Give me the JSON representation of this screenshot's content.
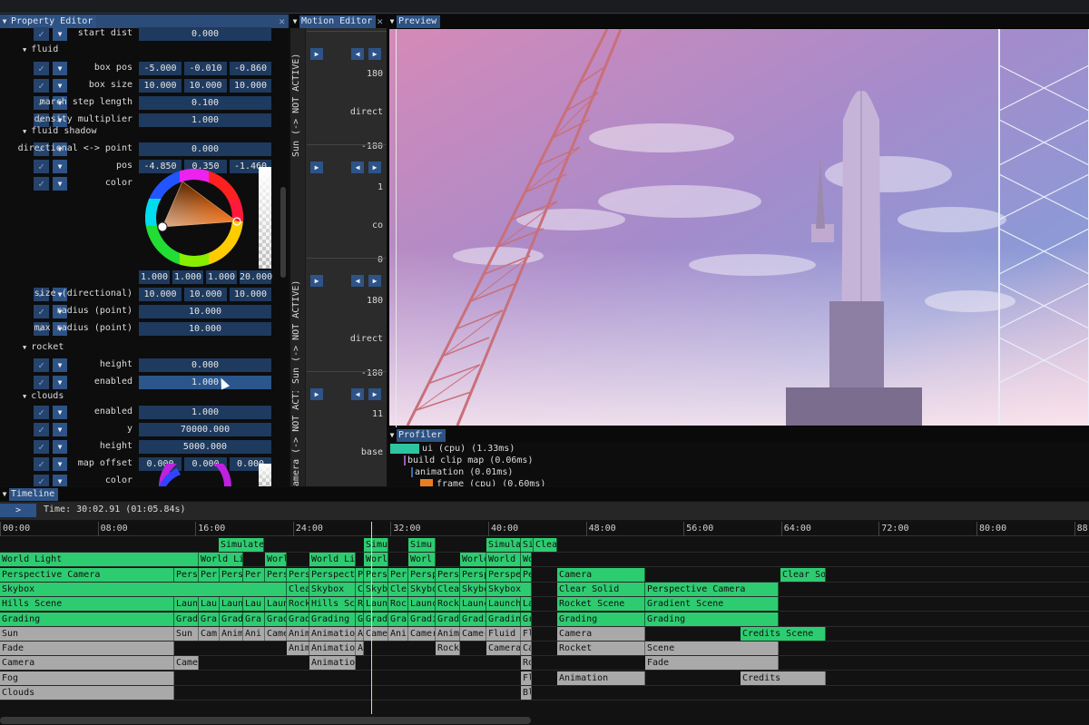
{
  "property_editor": {
    "title": "Property Editor",
    "rows": [
      {
        "type": "prop",
        "label": "start dist",
        "values": [
          "0.000"
        ]
      },
      {
        "type": "section",
        "label": "fluid"
      },
      {
        "type": "prop",
        "label": "box pos",
        "values": [
          "-5.000",
          "-0.010",
          "-0.860"
        ]
      },
      {
        "type": "prop",
        "label": "box size",
        "values": [
          "10.000",
          "10.000",
          "10.000"
        ]
      },
      {
        "type": "prop",
        "label": "march step length",
        "values": [
          "0.100"
        ]
      },
      {
        "type": "prop",
        "label": "density multiplier",
        "values": [
          "1.000"
        ]
      },
      {
        "type": "section",
        "label": "fluid shadow"
      },
      {
        "type": "prop",
        "label": "directional <-> point",
        "values": [
          "0.000"
        ]
      },
      {
        "type": "prop",
        "label": "pos",
        "values": [
          "-4.850",
          "0.350",
          "-1.460"
        ]
      },
      {
        "type": "prop",
        "label": "color",
        "values": []
      },
      {
        "type": "rgba",
        "values": [
          "1.000",
          "1.000",
          "1.000",
          "20.000"
        ]
      },
      {
        "type": "prop",
        "label": "size (directional)",
        "values": [
          "10.000",
          "10.000",
          "10.000"
        ]
      },
      {
        "type": "prop",
        "label": "radius (point)",
        "values": [
          "10.000"
        ]
      },
      {
        "type": "prop",
        "label": "max radius (point)",
        "values": [
          "10.000"
        ]
      },
      {
        "type": "section",
        "label": "rocket"
      },
      {
        "type": "prop",
        "label": "height",
        "values": [
          "0.000"
        ]
      },
      {
        "type": "prop",
        "label": "enabled",
        "values": [
          "1.000"
        ],
        "highlight": true
      },
      {
        "type": "section",
        "label": "clouds"
      },
      {
        "type": "prop",
        "label": "enabled",
        "values": [
          "1.000"
        ]
      },
      {
        "type": "prop",
        "label": "y",
        "values": [
          "70000.000"
        ]
      },
      {
        "type": "prop",
        "label": "height",
        "values": [
          "5000.000"
        ]
      },
      {
        "type": "prop",
        "label": "map offset",
        "values": [
          "0.000",
          "0.000",
          "0.000"
        ]
      },
      {
        "type": "prop",
        "label": "color",
        "values": []
      }
    ],
    "checkmark": "✓",
    "dropdown": "▼",
    "section_arrow": "▼"
  },
  "motion_editor": {
    "title": "Motion Editor",
    "vertical_labels": [
      "Sun (-> NOT ACTIVE)",
      "Sun (-> NOT ACTIVE)",
      "amera (-> NOT ACTIVE"
    ],
    "blocks": [
      {
        "top": "180",
        "mid": "direct",
        "bottom": "-180"
      },
      {
        "top": "1",
        "mid": "co",
        "bottom": "0"
      },
      {
        "top": "180",
        "mid": "direct",
        "bottom": "-180"
      },
      {
        "top": "11",
        "mid": "base",
        "bottom": ""
      }
    ]
  },
  "preview": {
    "title": "Preview"
  },
  "profiler": {
    "title": "Profiler",
    "entries": [
      {
        "label": "ui (cpu) (1.33ms)",
        "color": "#2ec4a0"
      },
      {
        "label": "build clip map (0.06ms)",
        "color": "#9b59b6"
      },
      {
        "label": "animation (0.01ms)",
        "color": "#3a6ea5"
      },
      {
        "label": "frame (cpu) (0.60ms)",
        "color": "#e67e22"
      }
    ]
  },
  "timeline": {
    "title": "Timeline",
    "play_label": ">",
    "time_label": "Time: 30:02.91 (01:05.84s)",
    "ticks": [
      "00:00",
      "08:00",
      "16:00",
      "24:00",
      "32:00",
      "40:00",
      "48:00",
      "56:00",
      "64:00",
      "72:00",
      "80:00",
      "88:00"
    ],
    "tracks": [
      [
        {
          "s": 241,
          "e": 291,
          "t": "Simulate",
          "c": "g"
        },
        {
          "s": 401,
          "e": 428,
          "t": "Simu",
          "c": "g"
        },
        {
          "s": 450,
          "e": 480,
          "t": "Simu",
          "c": "g"
        },
        {
          "s": 536,
          "e": 574,
          "t": "Simula",
          "c": "g"
        },
        {
          "s": 574,
          "e": 588,
          "t": "Si",
          "c": "g"
        },
        {
          "s": 588,
          "e": 614,
          "t": "Clea",
          "c": "g"
        }
      ],
      [
        {
          "s": 0,
          "e": 219,
          "t": "World Light",
          "c": "g"
        },
        {
          "s": 219,
          "e": 268,
          "t": "World Li",
          "c": "g"
        },
        {
          "s": 292,
          "e": 316,
          "t": "Worl",
          "c": "g"
        },
        {
          "s": 341,
          "e": 392,
          "t": "World Li",
          "c": "g"
        },
        {
          "s": 401,
          "e": 428,
          "t": "Worl",
          "c": "g"
        },
        {
          "s": 450,
          "e": 480,
          "t": "Worl",
          "c": "g"
        },
        {
          "s": 507,
          "e": 536,
          "t": "World",
          "c": "g"
        },
        {
          "s": 536,
          "e": 574,
          "t": "World",
          "c": "g"
        },
        {
          "s": 574,
          "e": 586,
          "t": "Wo",
          "c": "g"
        }
      ],
      [
        {
          "s": 0,
          "e": 192,
          "t": "Perspective Camera",
          "c": "g"
        },
        {
          "s": 192,
          "e": 219,
          "t": "Pers",
          "c": "g"
        },
        {
          "s": 219,
          "e": 242,
          "t": "Per",
          "c": "g"
        },
        {
          "s": 242,
          "e": 268,
          "t": "Pers",
          "c": "g"
        },
        {
          "s": 268,
          "e": 292,
          "t": "Per",
          "c": "g"
        },
        {
          "s": 292,
          "e": 316,
          "t": "Pers",
          "c": "g"
        },
        {
          "s": 316,
          "e": 341,
          "t": "Pers",
          "c": "g"
        },
        {
          "s": 341,
          "e": 392,
          "t": "Perspect",
          "c": "g"
        },
        {
          "s": 392,
          "e": 401,
          "t": "P",
          "c": "g"
        },
        {
          "s": 401,
          "e": 428,
          "t": "Pers",
          "c": "g"
        },
        {
          "s": 428,
          "e": 450,
          "t": "Per",
          "c": "g"
        },
        {
          "s": 450,
          "e": 480,
          "t": "Persp",
          "c": "g"
        },
        {
          "s": 480,
          "e": 507,
          "t": "Pers",
          "c": "g"
        },
        {
          "s": 507,
          "e": 536,
          "t": "Persp",
          "c": "g"
        },
        {
          "s": 536,
          "e": 574,
          "t": "Perspe",
          "c": "g"
        },
        {
          "s": 574,
          "e": 586,
          "t": "Pe",
          "c": "g"
        },
        {
          "s": 614,
          "e": 711,
          "t": "Camera",
          "c": "g"
        },
        {
          "s": 860,
          "e": 910,
          "t": "Clear So",
          "c": "g"
        }
      ],
      [
        {
          "s": 0,
          "e": 316,
          "t": "Skybox",
          "c": "g"
        },
        {
          "s": 316,
          "e": 341,
          "t": "Clea",
          "c": "g"
        },
        {
          "s": 341,
          "e": 392,
          "t": "Skybox",
          "c": "g"
        },
        {
          "s": 392,
          "e": 401,
          "t": "C",
          "c": "g"
        },
        {
          "s": 401,
          "e": 428,
          "t": "Skyb",
          "c": "g"
        },
        {
          "s": 428,
          "e": 450,
          "t": "Cle",
          "c": "g"
        },
        {
          "s": 450,
          "e": 480,
          "t": "Skybo",
          "c": "g"
        },
        {
          "s": 480,
          "e": 507,
          "t": "Clea",
          "c": "g"
        },
        {
          "s": 507,
          "e": 536,
          "t": "Skybo",
          "c": "g"
        },
        {
          "s": 536,
          "e": 586,
          "t": "Skybox",
          "c": "g"
        },
        {
          "s": 614,
          "e": 711,
          "t": "Clear Solid",
          "c": "g"
        },
        {
          "s": 711,
          "e": 858,
          "t": "Perspective Camera",
          "c": "g"
        }
      ],
      [
        {
          "s": 0,
          "e": 192,
          "t": "Hills Scene",
          "c": "g"
        },
        {
          "s": 192,
          "e": 219,
          "t": "Laun",
          "c": "g"
        },
        {
          "s": 219,
          "e": 242,
          "t": "Lau",
          "c": "g"
        },
        {
          "s": 242,
          "e": 268,
          "t": "Laun",
          "c": "g"
        },
        {
          "s": 268,
          "e": 292,
          "t": "Lau",
          "c": "g"
        },
        {
          "s": 292,
          "e": 316,
          "t": "Laun",
          "c": "g"
        },
        {
          "s": 316,
          "e": 341,
          "t": "Rock",
          "c": "g"
        },
        {
          "s": 341,
          "e": 392,
          "t": "Hills Sc",
          "c": "g"
        },
        {
          "s": 392,
          "e": 401,
          "t": "R",
          "c": "g"
        },
        {
          "s": 401,
          "e": 428,
          "t": "Laun",
          "c": "g"
        },
        {
          "s": 428,
          "e": 450,
          "t": "Roc",
          "c": "g"
        },
        {
          "s": 450,
          "e": 480,
          "t": "Launc",
          "c": "g"
        },
        {
          "s": 480,
          "e": 507,
          "t": "Rock",
          "c": "g"
        },
        {
          "s": 507,
          "e": 536,
          "t": "Launc",
          "c": "g"
        },
        {
          "s": 536,
          "e": 574,
          "t": "Launch",
          "c": "g"
        },
        {
          "s": 574,
          "e": 586,
          "t": "La",
          "c": "g"
        },
        {
          "s": 614,
          "e": 711,
          "t": "Rocket Scene",
          "c": "g"
        },
        {
          "s": 711,
          "e": 858,
          "t": "Gradient Scene",
          "c": "g"
        }
      ],
      [
        {
          "s": 0,
          "e": 192,
          "t": "Grading",
          "c": "g"
        },
        {
          "s": 192,
          "e": 219,
          "t": "Grad",
          "c": "g"
        },
        {
          "s": 219,
          "e": 242,
          "t": "Gra",
          "c": "g"
        },
        {
          "s": 242,
          "e": 268,
          "t": "Grad",
          "c": "g"
        },
        {
          "s": 268,
          "e": 292,
          "t": "Gra",
          "c": "g"
        },
        {
          "s": 292,
          "e": 316,
          "t": "Grad",
          "c": "g"
        },
        {
          "s": 316,
          "e": 341,
          "t": "Grad",
          "c": "g"
        },
        {
          "s": 341,
          "e": 392,
          "t": "Grading",
          "c": "g"
        },
        {
          "s": 392,
          "e": 401,
          "t": "G",
          "c": "g"
        },
        {
          "s": 401,
          "e": 428,
          "t": "Grad",
          "c": "g"
        },
        {
          "s": 428,
          "e": 450,
          "t": "Gra",
          "c": "g"
        },
        {
          "s": 450,
          "e": 480,
          "t": "Gradi",
          "c": "g"
        },
        {
          "s": 480,
          "e": 507,
          "t": "Grad",
          "c": "g"
        },
        {
          "s": 507,
          "e": 536,
          "t": "Gradi",
          "c": "g"
        },
        {
          "s": 536,
          "e": 574,
          "t": "Gradin",
          "c": "g"
        },
        {
          "s": 574,
          "e": 586,
          "t": "Gr",
          "c": "g"
        },
        {
          "s": 614,
          "e": 711,
          "t": "Grading",
          "c": "g"
        },
        {
          "s": 711,
          "e": 858,
          "t": "Grading",
          "c": "g"
        }
      ],
      [
        {
          "s": 0,
          "e": 192,
          "t": "Sun",
          "c": "gr"
        },
        {
          "s": 192,
          "e": 219,
          "t": "Sun",
          "c": "gr"
        },
        {
          "s": 219,
          "e": 242,
          "t": "Cam",
          "c": "gr"
        },
        {
          "s": 242,
          "e": 268,
          "t": "Anim",
          "c": "gr"
        },
        {
          "s": 268,
          "e": 292,
          "t": "Ani",
          "c": "gr"
        },
        {
          "s": 292,
          "e": 316,
          "t": "Came",
          "c": "gr"
        },
        {
          "s": 316,
          "e": 341,
          "t": "Anim",
          "c": "gr"
        },
        {
          "s": 341,
          "e": 392,
          "t": "Animatio",
          "c": "gr"
        },
        {
          "s": 392,
          "e": 401,
          "t": "A",
          "c": "gr"
        },
        {
          "s": 401,
          "e": 428,
          "t": "Came",
          "c": "gr"
        },
        {
          "s": 428,
          "e": 450,
          "t": "Ani",
          "c": "gr"
        },
        {
          "s": 450,
          "e": 480,
          "t": "Camer",
          "c": "gr"
        },
        {
          "s": 480,
          "e": 507,
          "t": "Anim",
          "c": "gr"
        },
        {
          "s": 507,
          "e": 536,
          "t": "Camer",
          "c": "gr"
        },
        {
          "s": 536,
          "e": 574,
          "t": "Fluid",
          "c": "gr"
        },
        {
          "s": 574,
          "e": 586,
          "t": "Fl",
          "c": "gr"
        },
        {
          "s": 614,
          "e": 711,
          "t": "Camera",
          "c": "gr"
        },
        {
          "s": 816,
          "e": 910,
          "t": "Credits Scene",
          "c": "g"
        }
      ],
      [
        {
          "s": 0,
          "e": 192,
          "t": "Fade",
          "c": "gr"
        },
        {
          "s": 316,
          "e": 341,
          "t": "Anim",
          "c": "gr"
        },
        {
          "s": 341,
          "e": 392,
          "t": "Animatio",
          "c": "gr"
        },
        {
          "s": 392,
          "e": 401,
          "t": "A",
          "c": "gr"
        },
        {
          "s": 480,
          "e": 507,
          "t": "Rock",
          "c": "gr"
        },
        {
          "s": 536,
          "e": 574,
          "t": "Camera",
          "c": "gr"
        },
        {
          "s": 574,
          "e": 586,
          "t": "Ca",
          "c": "gr"
        },
        {
          "s": 614,
          "e": 711,
          "t": "Rocket",
          "c": "gr"
        },
        {
          "s": 711,
          "e": 858,
          "t": "Scene",
          "c": "gr"
        }
      ],
      [
        {
          "s": 0,
          "e": 192,
          "t": "Camera",
          "c": "gr"
        },
        {
          "s": 192,
          "e": 219,
          "t": "Came",
          "c": "gr"
        },
        {
          "s": 341,
          "e": 392,
          "t": "Animatio",
          "c": "gr"
        },
        {
          "s": 574,
          "e": 586,
          "t": "Ro",
          "c": "gr"
        },
        {
          "s": 711,
          "e": 858,
          "t": "Fade",
          "c": "gr"
        }
      ],
      [
        {
          "s": 0,
          "e": 192,
          "t": "Fog",
          "c": "gr"
        },
        {
          "s": 574,
          "e": 586,
          "t": "Fl",
          "c": "gr"
        },
        {
          "s": 614,
          "e": 711,
          "t": "Animation",
          "c": "gr"
        },
        {
          "s": 816,
          "e": 910,
          "t": "Credits",
          "c": "gr"
        }
      ],
      [
        {
          "s": 0,
          "e": 192,
          "t": "Clouds",
          "c": "gr"
        },
        {
          "s": 574,
          "e": 586,
          "t": "Bl",
          "c": "gr"
        }
      ]
    ]
  }
}
